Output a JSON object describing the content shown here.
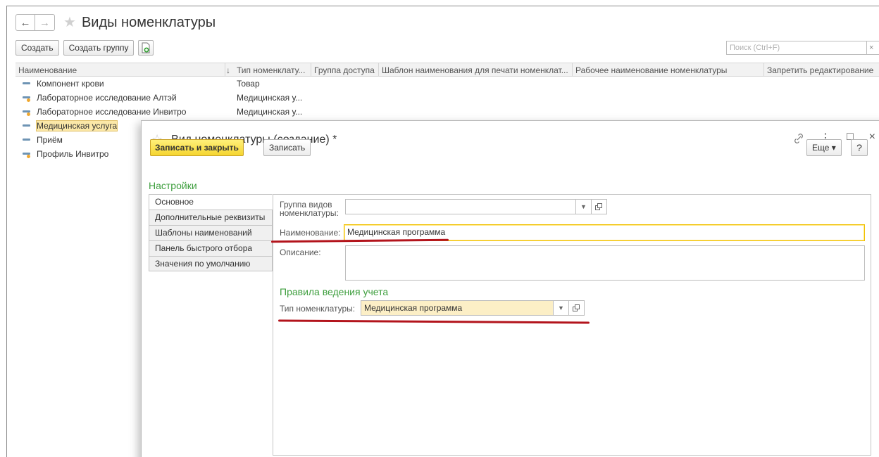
{
  "main": {
    "back": "←",
    "forward": "→",
    "title": "Виды номенклатуры",
    "create_label": "Создать",
    "create_group_label": "Создать группу",
    "search_placeholder": "Поиск (Ctrl+F)",
    "search_clear": "×"
  },
  "list": {
    "columns": [
      "Наименование",
      "↓",
      "Тип номенклату...",
      "Группа доступа",
      "Шаблон наименования для печати номенклат...",
      "Рабочее наименование номенклатуры",
      "Запретить редактирование"
    ],
    "rows": [
      {
        "name": "Компонент крови",
        "type": "Товар"
      },
      {
        "name": "Лабораторное исследование Алтэй",
        "type": "Медицинская у..."
      },
      {
        "name": "Лабораторное исследование Инвитро",
        "type": "Медицинская у..."
      },
      {
        "name": "Медицинская услуга",
        "type": ""
      },
      {
        "name": "Приём",
        "type": ""
      },
      {
        "name": "Профиль Инвитро",
        "type": ""
      }
    ]
  },
  "dialog": {
    "title": "Вид номенклатуры (создание) *",
    "link_icon": "link-icon",
    "menu_icon": "⋮",
    "maximize_icon": "□",
    "close_icon": "×",
    "save_close_label": "Записать и закрыть",
    "save_label": "Записать",
    "more_label": "Еще ▾",
    "help_label": "?",
    "settings_title": "Настройки",
    "tabs": [
      "Основное",
      "Дополнительные реквизиты",
      "Шаблоны наименований",
      "Панель быстрого отбора",
      "Значения по умолчанию"
    ],
    "group_label": "Группа видов номенклатуры:",
    "group_value": "",
    "name_label": "Наименование:",
    "name_value": "Медицинская программа",
    "description_label": "Описание:",
    "description_value": "",
    "accounting_title": "Правила ведения учета",
    "type_label": "Тип номенклатуры:",
    "type_value": "Медицинская программа"
  },
  "colors": {
    "accent_yellow": "#f5d530",
    "section_green": "#3f9f3f",
    "annotation_red": "#b3141c",
    "selection": "#fbe8a8"
  }
}
